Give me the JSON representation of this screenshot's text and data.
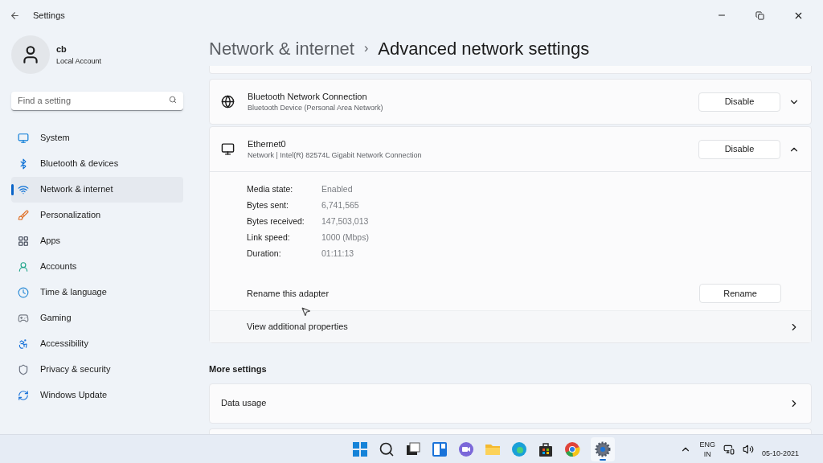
{
  "window": {
    "title": "Settings"
  },
  "account": {
    "name": "cb",
    "type": "Local Account"
  },
  "search": {
    "placeholder": "Find a setting"
  },
  "sidebar": {
    "items": [
      {
        "label": "System",
        "selected": false
      },
      {
        "label": "Bluetooth & devices",
        "selected": false
      },
      {
        "label": "Network & internet",
        "selected": true
      },
      {
        "label": "Personalization",
        "selected": false
      },
      {
        "label": "Apps",
        "selected": false
      },
      {
        "label": "Accounts",
        "selected": false
      },
      {
        "label": "Time & language",
        "selected": false
      },
      {
        "label": "Gaming",
        "selected": false
      },
      {
        "label": "Accessibility",
        "selected": false
      },
      {
        "label": "Privacy & security",
        "selected": false
      },
      {
        "label": "Windows Update",
        "selected": false
      }
    ]
  },
  "breadcrumb": {
    "parent": "Network & internet",
    "separator": "›",
    "current": "Advanced network settings"
  },
  "adapters": [
    {
      "kind": "bluetooth",
      "name": "Bluetooth Network Connection",
      "description": "Bluetooth Device (Personal Area Network)",
      "button": "Disable",
      "expanded": false
    },
    {
      "kind": "ethernet",
      "name": "Ethernet0",
      "description": "Network | Intel(R) 82574L Gigabit Network Connection",
      "button": "Disable",
      "expanded": true,
      "details": [
        {
          "label": "Media state:",
          "value": "Enabled"
        },
        {
          "label": "Bytes sent:",
          "value": "6,741,565"
        },
        {
          "label": "Bytes received:",
          "value": "147,503,013"
        },
        {
          "label": "Link speed:",
          "value": "1000 (Mbps)"
        },
        {
          "label": "Duration:",
          "value": "01:11:13"
        }
      ],
      "rename": {
        "label": "Rename this adapter",
        "button": "Rename"
      },
      "properties": {
        "label": "View additional properties"
      }
    }
  ],
  "more_settings": {
    "heading": "More settings",
    "items": [
      {
        "label": "Data usage"
      }
    ]
  },
  "taskbar": {
    "language": "ENG",
    "region": "IN",
    "date": "05-10-2021"
  }
}
